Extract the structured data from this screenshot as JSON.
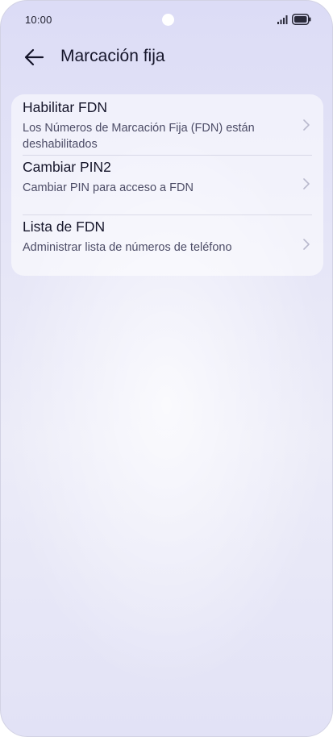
{
  "status_bar": {
    "time": "10:00",
    "signal_icon": "signal-icon",
    "battery_icon": "battery-icon"
  },
  "header": {
    "back_icon": "arrow-left-icon",
    "title": "Marcación fija"
  },
  "settings": {
    "items": [
      {
        "title": "Habilitar FDN",
        "subtitle": "Los Números de Marcación Fija (FDN) están deshabilitados",
        "icon": "chevron-right-icon"
      },
      {
        "title": "Cambiar PIN2",
        "subtitle": "Cambiar PIN para acceso a FDN",
        "icon": "chevron-right-icon"
      },
      {
        "title": "Lista de FDN",
        "subtitle": "Administrar lista de números de teléfono",
        "icon": "chevron-right-icon"
      }
    ]
  },
  "colors": {
    "background": "#e6e6f7",
    "text_primary": "#15152a",
    "text_secondary": "#4c4c66",
    "chevron": "#b8b8cc"
  }
}
